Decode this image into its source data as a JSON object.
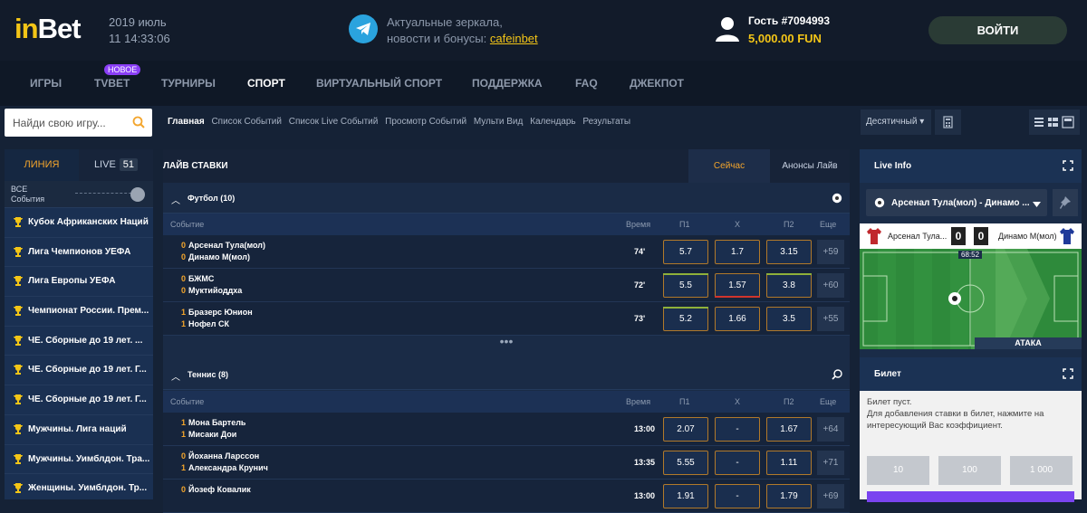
{
  "header": {
    "logo_text_prefix": "in",
    "logo_text_suffix": "Bet",
    "date_line": "2019 июль",
    "time_line": "11 14:33:06",
    "telegram_icon": "telegram-icon",
    "mirrors_line1": "Актуальные зеркала,",
    "mirrors_line2": "новости и бонусы:",
    "mirrors_link": "cafeinbet",
    "guest_name": "Гость #7094993",
    "balance": "5,000.00 FUN",
    "login_label": "ВОЙТИ"
  },
  "nav": {
    "items": [
      "ИГРЫ",
      "TVBET",
      "ТУРНИРЫ",
      "СПОРТ",
      "ВИРТУАЛЬНЫЙ СПОРТ",
      "ПОДДЕРЖКА",
      "FAQ",
      "ДЖЕКПОТ"
    ],
    "active": "СПОРТ",
    "new_badge": "НОВОЕ"
  },
  "subnav": {
    "search_placeholder": "Найди свою игру...",
    "crumbs": [
      "Главная",
      "Список Событий",
      "Список Live Событий",
      "Просмотр Событий",
      "Мульти Вид",
      "Календарь",
      "Результаты"
    ],
    "odds_format": "Десятичный"
  },
  "sidebar": {
    "tab_line": "ЛИНИЯ",
    "tab_live": "LIVE",
    "live_count": "51",
    "all_events_line1": "ВСЕ",
    "all_events_line2": "События",
    "leagues": [
      "Кубок Африканских Наций",
      "Лига Чемпионов УЕФА",
      "Лига Европы УЕФА",
      "Чемпионат России. Прем...",
      "ЧЕ. Сборные до 19 лет. ...",
      "ЧЕ. Сборные до 19 лет. Г...",
      "ЧЕ. Сборные до 19 лет. Г...",
      "Мужчины. Лига наций",
      "Мужчины. Уимблдон. Тра...",
      "Женщины. Уимблдон. Тр..."
    ]
  },
  "main": {
    "title": "ЛАЙВ СТАВКИ",
    "tab_now": "Сейчас",
    "tab_announce": "Анонсы Лайв",
    "columns": {
      "event": "Событие",
      "time": "Время",
      "p1": "П1",
      "x": "X",
      "p2": "П2",
      "more": "Еще"
    },
    "football": {
      "title": "Футбол (10)",
      "rows": [
        {
          "s1": "0",
          "t1": "Арсенал Тула(мол)",
          "s2": "0",
          "t2": "Динамо М(мол)",
          "time": "74'",
          "p1": "5.7",
          "x": "1.7",
          "p2": "3.15",
          "more": "+59"
        },
        {
          "s1": "0",
          "t1": "БЖМС",
          "s2": "0",
          "t2": "Муктийоддха",
          "time": "72'",
          "p1": "5.5",
          "x": "1.57",
          "p2": "3.8",
          "more": "+60"
        },
        {
          "s1": "1",
          "t1": "Бразерс Юнион",
          "s2": "1",
          "t2": "Нофел СК",
          "time": "73'",
          "p1": "5.2",
          "x": "1.66",
          "p2": "3.5",
          "more": "+55"
        }
      ],
      "more_dots": "•••"
    },
    "tennis": {
      "title": "Теннис (8)",
      "rows": [
        {
          "s1": "1",
          "t1": "Мона Бартель",
          "s2": "1",
          "t2": "Мисаки Дои",
          "time": "13:00",
          "p1": "2.07",
          "x": "-",
          "p2": "1.67",
          "more": "+64"
        },
        {
          "s1": "0",
          "t1": "Йоханна Ларссон",
          "s2": "1",
          "t2": "Александра Крунич",
          "time": "13:35",
          "p1": "5.55",
          "x": "-",
          "p2": "1.11",
          "more": "+71"
        },
        {
          "s1": "0",
          "t1": "Йозеф Ковалик",
          "s2": "",
          "t2": "",
          "time": "13:00",
          "p1": "1.91",
          "x": "-",
          "p2": "1.79",
          "more": "+69"
        }
      ]
    }
  },
  "right": {
    "live_info_title": "Live Info",
    "match_select": "Арсенал Тула(мол) - Динамо ...",
    "home_team": "Арсенал Тула...",
    "away_team": "Динамо М(мол)",
    "home_score": "0",
    "away_score": "0",
    "clock": "68:52",
    "attack_label": "АТАКА",
    "ticket_title": "Билет",
    "ticket_empty": "Билет пуст.",
    "ticket_hint": "Для добавления ставки в билет, нажмите на интересующий Вас коэффициент.",
    "stakes": [
      "10",
      "100",
      "1 000"
    ]
  },
  "colors": {
    "accent": "#f3c517",
    "orange": "#f3a52c",
    "purple": "#8a3ef6",
    "telegram": "#2aa3de"
  }
}
